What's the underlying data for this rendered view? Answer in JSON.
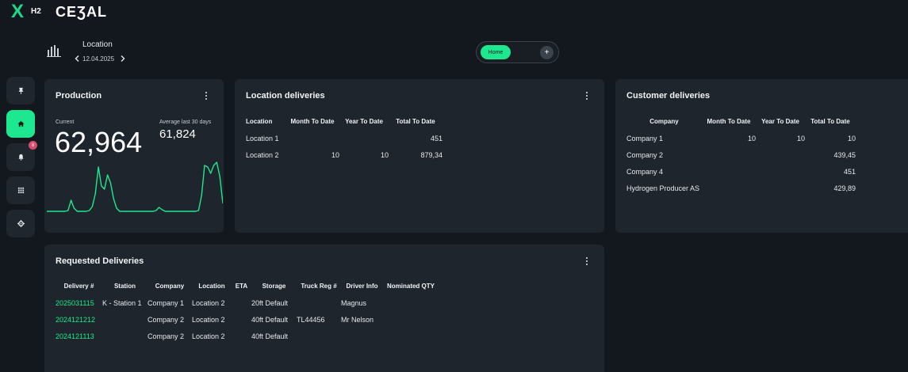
{
  "brand": {
    "logo": "X",
    "sub": "H2",
    "name": "CEƷAL"
  },
  "location": {
    "title": "Location",
    "date": "12.04.2025"
  },
  "tabs": {
    "home_label": "Home",
    "add_label": "+"
  },
  "sidebar": {
    "items": [
      {
        "name": "pin",
        "icon": "pin-icon"
      },
      {
        "name": "home",
        "icon": "home-icon",
        "active": true
      },
      {
        "name": "notifications",
        "icon": "bell-icon",
        "badge": "8"
      },
      {
        "name": "apps",
        "icon": "grid-icon"
      },
      {
        "name": "settings",
        "icon": "gear-icon"
      }
    ]
  },
  "colors": {
    "accent": "#1ee88f",
    "card": "#1f252c",
    "background": "#13181e",
    "badge": "#d94b6a"
  },
  "production": {
    "title": "Production",
    "current_label": "Current",
    "current_value": "62,964",
    "avg_label": "Average last 30 days",
    "avg_value": "61,824",
    "sparkline": [
      2,
      2,
      2,
      2,
      2,
      2,
      2,
      3,
      16,
      6,
      2,
      2,
      2,
      2,
      3,
      8,
      24,
      58,
      34,
      30,
      48,
      38,
      18,
      6,
      2,
      2,
      2,
      2,
      2,
      2,
      2,
      2,
      2,
      2,
      2,
      2,
      3,
      7,
      4,
      2,
      2,
      2,
      2,
      2,
      2,
      2,
      2,
      2,
      2,
      2,
      3,
      22,
      60,
      58,
      50,
      60,
      64,
      46,
      12
    ]
  },
  "location_deliveries": {
    "title": "Location deliveries",
    "headers": [
      "Location",
      "Month To Date",
      "Year To Date",
      "Total To Date"
    ],
    "rows": [
      [
        "Location 1",
        "",
        "",
        "451"
      ],
      [
        "Location 2",
        "10",
        "10",
        "879,34"
      ]
    ]
  },
  "customer_deliveries": {
    "title": "Customer deliveries",
    "headers": [
      "Company",
      "Month To Date",
      "Year To Date",
      "Total To Date"
    ],
    "rows": [
      [
        "Company 1",
        "10",
        "10",
        "10"
      ],
      [
        "Company 2",
        "",
        "",
        "439,45"
      ],
      [
        "Company 4",
        "",
        "",
        "451"
      ],
      [
        "Hydrogen Producer AS",
        "",
        "",
        "429,89"
      ]
    ]
  },
  "requested_deliveries": {
    "title": "Requested Deliveries",
    "headers": [
      "Delivery #",
      "Station",
      "Company",
      "Location",
      "ETA",
      "Storage",
      "Truck Reg #",
      "Driver Info",
      "Nominated QTY"
    ],
    "rows": [
      [
        "2025031115",
        "K - Station 1",
        "Company 1",
        "Location 2",
        "",
        "20ft Default",
        "",
        "Magnus",
        ""
      ],
      [
        "2024121212",
        "",
        "Company 2",
        "Location 2",
        "",
        "40ft Default",
        "TL44456",
        "Mr Nelson",
        ""
      ],
      [
        "2024121113",
        "",
        "Company 2",
        "Location 2",
        "",
        "40ft Default",
        "",
        "",
        ""
      ]
    ]
  }
}
